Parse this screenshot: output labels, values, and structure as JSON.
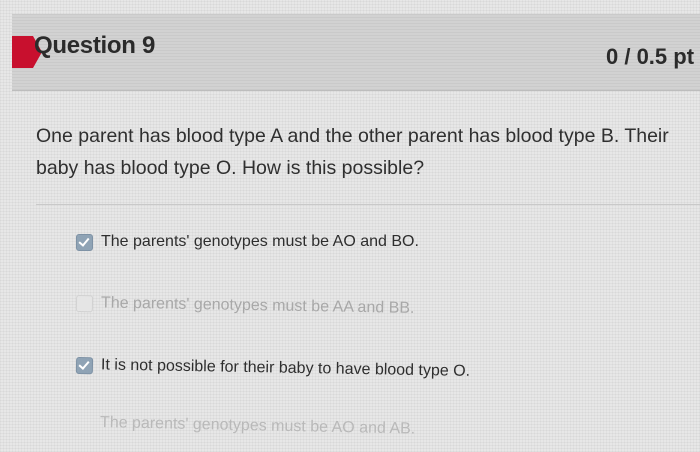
{
  "question": {
    "title": "Question 9",
    "score": "0 / 0.5 pt",
    "text": "One parent has blood type A and the other parent has blood type B. Their baby has blood type O.  How is this possible?"
  },
  "answers": [
    {
      "label": "The parents' genotypes must be AO and BO.",
      "checked": true
    },
    {
      "label": "The parents' genotypes must be AA and BB.",
      "checked": false
    },
    {
      "label": "It is not possible for their baby to have blood type O.",
      "checked": true
    },
    {
      "label": "The parents' genotypes must be AO and AB.",
      "checked": false
    }
  ],
  "colors": {
    "flag": "#c8102e",
    "checkbox_checked": "#8fa3b5"
  }
}
